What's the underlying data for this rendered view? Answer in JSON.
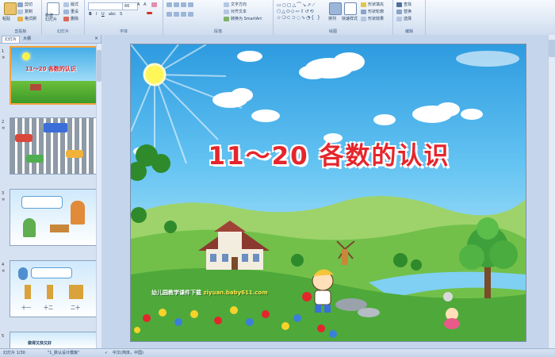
{
  "ribbon": {
    "clipboard": {
      "paste": "粘贴",
      "cut": "剪切",
      "copy": "复制",
      "format_painter": "格式刷",
      "label": "剪贴板"
    },
    "slides": {
      "new_slide": "新建\n幻灯片",
      "layout": "版式",
      "reset": "重设",
      "delete": "删除",
      "label": "幻灯片"
    },
    "font": {
      "size": "66",
      "label": "字体"
    },
    "paragraph": {
      "text_direction": "文字方向",
      "align_text": "对齐文本",
      "smartart": "转换为 SmartArt",
      "label": "段落"
    },
    "drawing": {
      "arrange": "排列",
      "quick_styles": "快速样式",
      "fill": "形状填充",
      "outline": "形状轮廓",
      "effects": "形状效果",
      "label": "绘图"
    },
    "editing": {
      "find": "查找",
      "replace": "替换",
      "select": "选择",
      "label": "编辑"
    }
  },
  "left_pane": {
    "tabs": [
      "幻灯片",
      "大纲"
    ],
    "close": "×",
    "slide1_title": "11～20 各数的认识",
    "slide4_row": [
      "十一",
      "十二",
      "二十"
    ],
    "slide5_text": "做得又快又好",
    "numbers": [
      "1",
      "2",
      "3",
      "4",
      "5"
    ]
  },
  "slide": {
    "title": "11～20 各数的认识",
    "footer_text": "幼儿园教学课件下载",
    "footer_url": "ziyuan.baby611.com"
  },
  "status": {
    "slide_count": "幻灯片 1/30",
    "theme": "\"1_默认设计模板\"",
    "language": "中文(简体，中国)"
  }
}
